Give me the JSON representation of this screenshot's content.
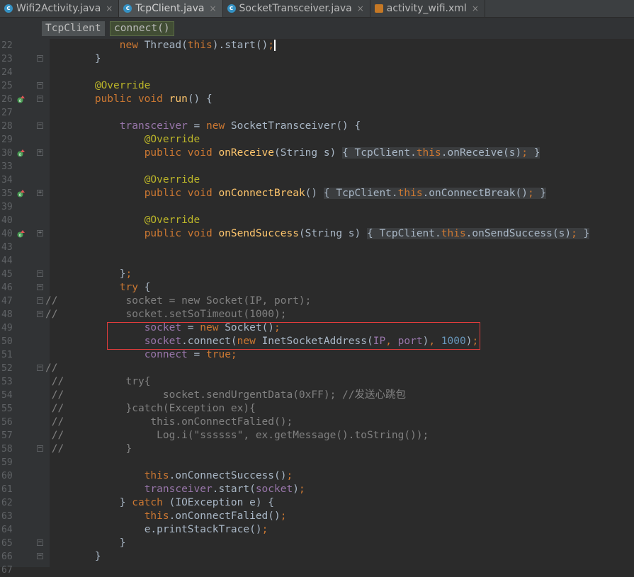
{
  "tabs": [
    {
      "label": "Wifi2Activity.java",
      "icon": "c",
      "active": false
    },
    {
      "label": "TcpClient.java",
      "icon": "c",
      "active": true
    },
    {
      "label": "SocketTransceiver.java",
      "icon": "c",
      "active": false
    },
    {
      "label": "activity_wifi.xml",
      "icon": "xml",
      "active": false
    }
  ],
  "breadcrumb": {
    "class_name": "TcpClient",
    "method_name": "connect()"
  },
  "lines": [
    {
      "n": "22",
      "tokens": [
        [
          "",
          "            "
        ],
        [
          "kw",
          "new "
        ],
        [
          "",
          "Thread("
        ],
        [
          "kw",
          "this"
        ],
        [
          "",
          ")."
        ],
        [
          "",
          "start()"
        ],
        [
          "kw",
          ";"
        ]
      ],
      "caret": true
    },
    {
      "n": "23",
      "tokens": [
        [
          "",
          "        }"
        ]
      ],
      "fold": "end"
    },
    {
      "n": "24",
      "tokens": []
    },
    {
      "n": "25",
      "tokens": [
        [
          "",
          "        "
        ],
        [
          "an",
          "@Override"
        ]
      ],
      "fold": "start"
    },
    {
      "n": "26",
      "tokens": [
        [
          "",
          "        "
        ],
        [
          "kw",
          "public void "
        ],
        [
          "fn",
          "run"
        ],
        [
          "",
          "() {"
        ]
      ],
      "mark": true,
      "fold": "start"
    },
    {
      "n": "27",
      "tokens": []
    },
    {
      "n": "28",
      "tokens": [
        [
          "",
          "            "
        ],
        [
          "fd",
          "transceiver"
        ],
        [
          "",
          " = "
        ],
        [
          "kw",
          "new "
        ],
        [
          "",
          "SocketTransceiver() {"
        ]
      ],
      "fold": "start"
    },
    {
      "n": "29",
      "tokens": [
        [
          "",
          "                "
        ],
        [
          "an",
          "@Override"
        ]
      ]
    },
    {
      "n": "30",
      "tokens": [
        [
          "",
          "                "
        ],
        [
          "kw",
          "public void "
        ],
        [
          "fn",
          "onReceive"
        ],
        [
          "",
          "(String s) "
        ],
        [
          "fb",
          "{ TcpClient."
        ],
        [
          "kwfb",
          "this"
        ],
        [
          "fb",
          ".onReceive(s)"
        ],
        [
          "kwfb",
          ";"
        ],
        [
          "fb",
          " }"
        ]
      ],
      "mark": true,
      "fold": "plus"
    },
    {
      "n": "33",
      "tokens": []
    },
    {
      "n": "34",
      "tokens": [
        [
          "",
          "                "
        ],
        [
          "an",
          "@Override"
        ]
      ]
    },
    {
      "n": "35",
      "tokens": [
        [
          "",
          "                "
        ],
        [
          "kw",
          "public void "
        ],
        [
          "fn",
          "onConnectBreak"
        ],
        [
          "",
          "() "
        ],
        [
          "fb",
          "{ TcpClient."
        ],
        [
          "kwfb",
          "this"
        ],
        [
          "fb",
          ".onConnectBreak()"
        ],
        [
          "kwfb",
          ";"
        ],
        [
          "fb",
          " }"
        ]
      ],
      "mark": true,
      "fold": "plus"
    },
    {
      "n": "39",
      "tokens": []
    },
    {
      "n": "40",
      "tokens": [
        [
          "",
          "                "
        ],
        [
          "an",
          "@Override"
        ]
      ]
    },
    {
      "n": "40",
      "tokens": [
        [
          "",
          "                "
        ],
        [
          "kw",
          "public void "
        ],
        [
          "fn",
          "onSendSuccess"
        ],
        [
          "",
          "(String s) "
        ],
        [
          "fb",
          "{ TcpClient."
        ],
        [
          "kwfb",
          "this"
        ],
        [
          "fb",
          ".onSendSuccess(s)"
        ],
        [
          "kwfb",
          ";"
        ],
        [
          "fb",
          " }"
        ]
      ],
      "mark": true,
      "fold": "plus"
    },
    {
      "n": "43",
      "tokens": []
    },
    {
      "n": "44",
      "tokens": []
    },
    {
      "n": "45",
      "tokens": [
        [
          "",
          "            }"
        ],
        [
          "kw",
          ";"
        ]
      ],
      "fold": "end"
    },
    {
      "n": "46",
      "tokens": [
        [
          "",
          "            "
        ],
        [
          "kw",
          "try "
        ],
        [
          "",
          "{"
        ]
      ],
      "fold": "start"
    },
    {
      "n": "47",
      "tokens": [
        [
          "cm",
          "//"
        ],
        [
          "cm",
          "           socket = new Socket(IP, port);"
        ]
      ],
      "gc": true,
      "fold": "start"
    },
    {
      "n": "48",
      "tokens": [
        [
          "cm",
          "//"
        ],
        [
          "cm",
          "           socket.setSoTimeout(1000);"
        ]
      ],
      "gc": true,
      "fold": "end"
    },
    {
      "n": "49",
      "tokens": [
        [
          "",
          "                "
        ],
        [
          "fd",
          "socket"
        ],
        [
          "",
          " = "
        ],
        [
          "kw",
          "new "
        ],
        [
          "",
          "Socket()"
        ],
        [
          "kw",
          ";"
        ]
      ]
    },
    {
      "n": "50",
      "tokens": [
        [
          "",
          "                "
        ],
        [
          "fd",
          "socket"
        ],
        [
          "",
          ".connect("
        ],
        [
          "kw",
          "new "
        ],
        [
          "",
          "InetSocketAddress("
        ],
        [
          "fd",
          "IP"
        ],
        [
          "kw",
          ", "
        ],
        [
          "fd",
          "port"
        ],
        [
          "",
          ")"
        ],
        [
          "kw",
          ", "
        ],
        [
          "nm",
          "1000"
        ],
        [
          "",
          ")"
        ],
        [
          "kw",
          ";"
        ]
      ]
    },
    {
      "n": "51",
      "tokens": [
        [
          "",
          "                "
        ],
        [
          "fd",
          "connect"
        ],
        [
          "",
          " = "
        ],
        [
          "kw",
          "true"
        ],
        [
          "kw",
          ";"
        ]
      ]
    },
    {
      "n": "52",
      "tokens": [
        [
          "cm",
          "//"
        ]
      ],
      "gc": true,
      "fold": "start"
    },
    {
      "n": "53",
      "tokens": [
        [
          "cm",
          " //"
        ],
        [
          "cm",
          "          try{"
        ]
      ],
      "gc": true
    },
    {
      "n": "54",
      "tokens": [
        [
          "cm",
          " //"
        ],
        [
          "cm",
          "                socket.sendUrgentData(0xFF); //发送心跳包"
        ]
      ],
      "gc": true
    },
    {
      "n": "55",
      "tokens": [
        [
          "cm",
          " //"
        ],
        [
          "cm",
          "          }catch(Exception ex){"
        ]
      ],
      "gc": true
    },
    {
      "n": "56",
      "tokens": [
        [
          "cm",
          " //"
        ],
        [
          "cm",
          "              this.onConnectFalied();"
        ]
      ],
      "gc": true
    },
    {
      "n": "57",
      "tokens": [
        [
          "cm",
          " //"
        ],
        [
          "cm",
          "               Log.i(\"ssssss\", ex.getMessage().toString());"
        ]
      ],
      "gc": true
    },
    {
      "n": "58",
      "tokens": [
        [
          "cm",
          " //"
        ],
        [
          "cm",
          "          }"
        ]
      ],
      "gc": true,
      "fold": "end"
    },
    {
      "n": "59",
      "tokens": []
    },
    {
      "n": "60",
      "tokens": [
        [
          "",
          "                "
        ],
        [
          "kw",
          "this"
        ],
        [
          "",
          ".onConnectSuccess()"
        ],
        [
          "kw",
          ";"
        ]
      ]
    },
    {
      "n": "61",
      "tokens": [
        [
          "",
          "                "
        ],
        [
          "fd",
          "transceiver"
        ],
        [
          "",
          ".start("
        ],
        [
          "fd",
          "socket"
        ],
        [
          "",
          ")"
        ],
        [
          "kw",
          ";"
        ]
      ]
    },
    {
      "n": "62",
      "tokens": [
        [
          "",
          "            } "
        ],
        [
          "kw",
          "catch "
        ],
        [
          "",
          "(IOException e) {"
        ]
      ]
    },
    {
      "n": "63",
      "tokens": [
        [
          "",
          "                "
        ],
        [
          "kw",
          "this"
        ],
        [
          "",
          ".onConnectFalied()"
        ],
        [
          "kw",
          ";"
        ]
      ]
    },
    {
      "n": "64",
      "tokens": [
        [
          "",
          "                "
        ],
        [
          "",
          "e.printStackTrace()"
        ],
        [
          "kw",
          ";"
        ]
      ]
    },
    {
      "n": "65",
      "tokens": [
        [
          "",
          "            }"
        ]
      ],
      "fold": "end"
    },
    {
      "n": "66",
      "tokens": [
        [
          "",
          "        }"
        ]
      ],
      "fold": "end"
    },
    {
      "n": "67",
      "tokens": []
    }
  ]
}
